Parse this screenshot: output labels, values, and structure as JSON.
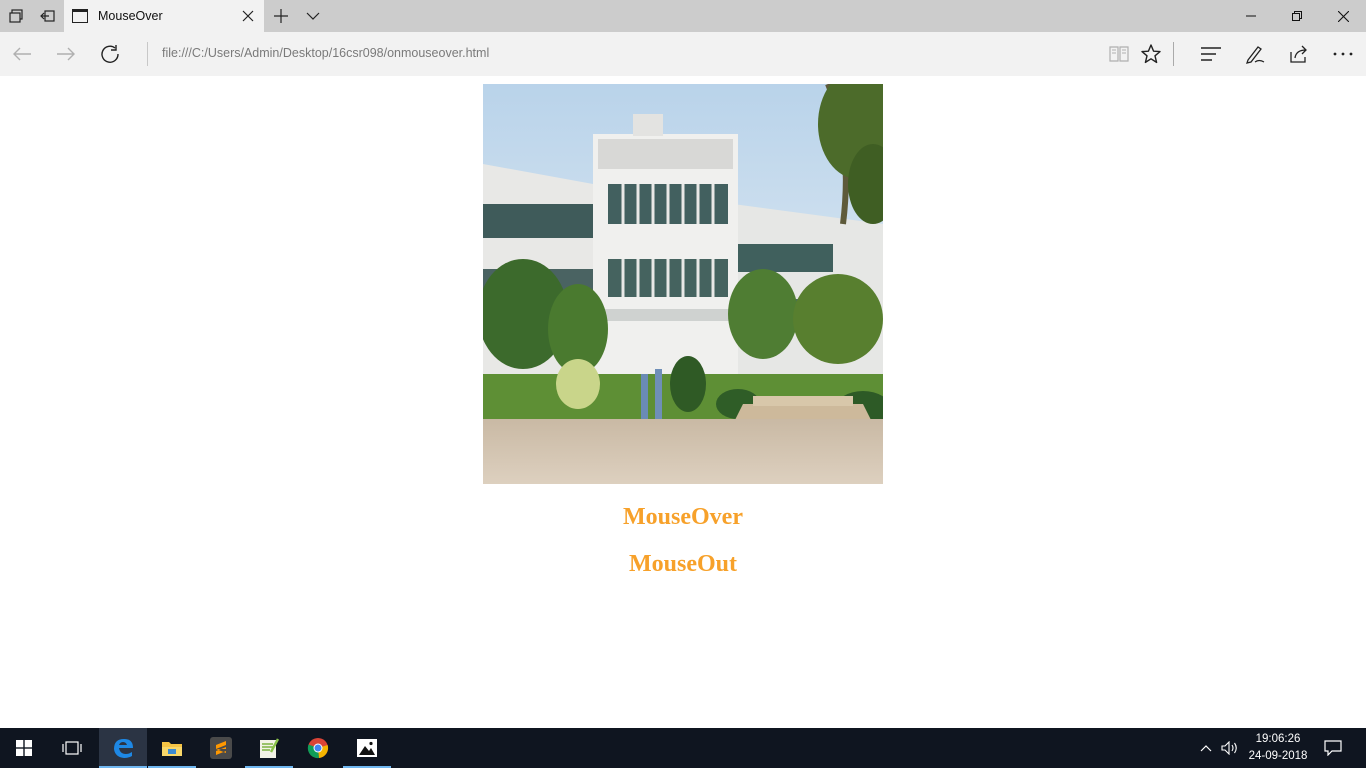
{
  "browser": {
    "tab_title": "MouseOver",
    "url": "file:///C:/Users/Admin/Desktop/16csr098/onmouseover.html"
  },
  "page": {
    "image_alt": "Campus building",
    "heading_1": "MouseOver",
    "heading_2": "MouseOut",
    "heading_color": "#f7a12a"
  },
  "taskbar": {
    "time": "19:06:26",
    "date": "24-09-2018",
    "apps": [
      "windows-start-icon",
      "task-view-icon",
      "edge-icon",
      "file-explorer-icon",
      "sublime-text-icon",
      "notepad-plus-icon",
      "chrome-icon",
      "photos-icon"
    ]
  }
}
